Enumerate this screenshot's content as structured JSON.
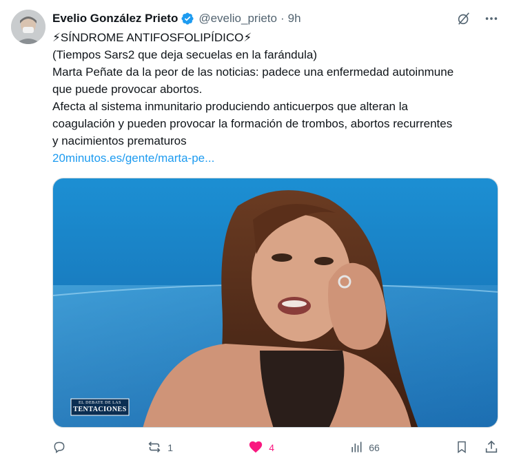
{
  "tweet": {
    "author_name": "Evelio González Prieto",
    "handle": "@evelio_prieto",
    "separator": "·",
    "time": "9h",
    "lines": [
      "⚡SÍNDROME ANTIFOSFOLIPÍDICO⚡",
      "(Tiempos Sars2 que deja secuelas en la farándula)",
      "Marta Peñate da la peor de las noticias: padece una enfermedad autoinmune",
      "que puede provocar abortos.",
      "Afecta al sistema inmunitario produciendo anticuerpos que alteran la",
      "coagulación y pueden provocar la formación de trombos, abortos recurrentes",
      "y nacimientos prematuros"
    ],
    "link_text": "20minutos.es/gente/marta-pe...",
    "media_caption_small": "EL DEBATE DE LAS",
    "media_caption_big": "TENTACIONES",
    "stats": {
      "replies": "",
      "reposts": "1",
      "likes": "4",
      "views": "66"
    }
  },
  "icons": {
    "verified": "verified-badge-icon",
    "grok": "grok-icon",
    "more": "more-icon",
    "reply": "reply-icon",
    "repost": "repost-icon",
    "like": "heart-filled-icon",
    "views": "views-bar-chart-icon",
    "bookmark": "bookmark-icon",
    "share": "share-icon"
  },
  "colors": {
    "accent": "#1d9bf0",
    "like": "#f91880",
    "muted": "#536471",
    "text": "#0f1419"
  }
}
